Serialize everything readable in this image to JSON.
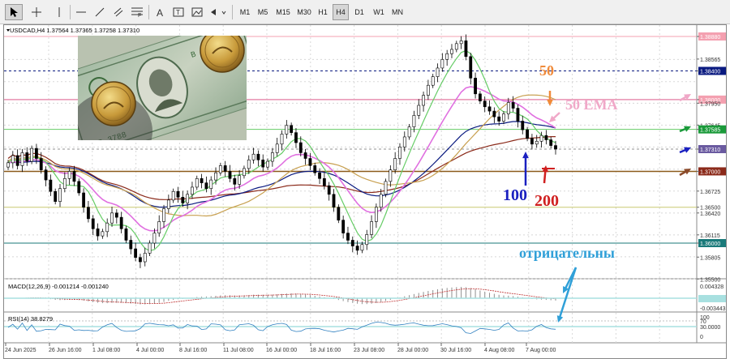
{
  "toolbar": {
    "timeframes": [
      "M1",
      "M5",
      "M15",
      "M30",
      "H1",
      "H4",
      "D1",
      "W1",
      "MN"
    ],
    "active_timeframe": "H4"
  },
  "chart": {
    "header": "USDCAD,H4  1.37564 1.37365 1.37258 1.37310",
    "price_labels": [
      "1.38880",
      "1.38565",
      "1.38400",
      "1.38000",
      "1.37950",
      "1.37645",
      "1.37585",
      "1.37310",
      "1.37000",
      "1.36725",
      "1.36500",
      "1.36420",
      "1.36115",
      "1.36000",
      "1.35805",
      "1.35500"
    ],
    "time_labels": [
      "24 Jun 2025",
      "26 Jun 16:00",
      "1 Jul 08:00",
      "4 Jul 00:00",
      "8 Jul 16:00",
      "11 Jul 08:00",
      "16 Jul 00:00",
      "18 Jul 16:00",
      "23 Jul 08:00",
      "28 Jul 00:00",
      "30 Jul 16:00",
      "4 Aug 08:00",
      "7 Aug 00:00"
    ],
    "annotations": {
      "ma50": "50",
      "ema50": "50 EMA",
      "ma100": "100",
      "ma200": "200",
      "negative": "отрицательны"
    },
    "colors": {
      "candle": "#000000",
      "ma_green": "#66cc66",
      "ma_pink": "#e070e0",
      "ma_tan": "#c8a050",
      "ma_navy": "#0a1a80",
      "ma_brown": "#8b2a1a"
    }
  },
  "macd": {
    "header": "MACD(12,26,9) -0.001214 -0.001240",
    "labels": [
      "0.004328",
      "0.000000",
      "-0.003443"
    ]
  },
  "rsi": {
    "header": "RSI(14) 38.8279",
    "labels": [
      "100",
      "70",
      "30.0000",
      "0"
    ]
  }
}
